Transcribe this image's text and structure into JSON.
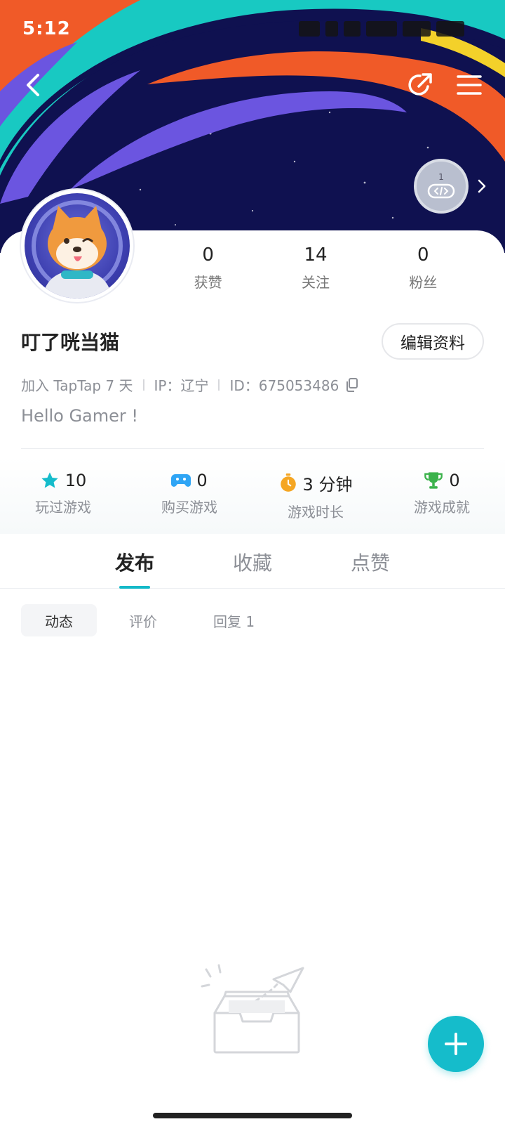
{
  "status_bar": {
    "time": "5:12"
  },
  "profile": {
    "username": "叮了咣当猫",
    "edit_label": "编辑资料",
    "joined": "加入 TapTap 7 天",
    "ip": "IP：辽宁",
    "id": "ID：675053486",
    "bio": "Hello Gamer !",
    "badge_level": "1"
  },
  "stats": [
    {
      "value": "0",
      "label": "获赞"
    },
    {
      "value": "14",
      "label": "关注"
    },
    {
      "value": "0",
      "label": "粉丝"
    }
  ],
  "game_stats": [
    {
      "icon": "star-icon",
      "value": "10",
      "label": "玩过游戏",
      "color": "#15bccb"
    },
    {
      "icon": "gamepad-icon",
      "value": "0",
      "label": "购买游戏",
      "color": "#2fa5f5"
    },
    {
      "icon": "timer-icon",
      "value": "3 分钟",
      "label": "游戏时长",
      "color": "#f5a623"
    },
    {
      "icon": "trophy-icon",
      "value": "0",
      "label": "游戏成就",
      "color": "#3bb24b"
    }
  ],
  "tabs": [
    {
      "label": "发布",
      "active": true
    },
    {
      "label": "收藏",
      "active": false
    },
    {
      "label": "点赞",
      "active": false
    }
  ],
  "subtabs": [
    {
      "label": "动态",
      "active": true
    },
    {
      "label": "评价",
      "active": false
    },
    {
      "label": "回复 1",
      "active": false
    }
  ],
  "colors": {
    "accent": "#15bccb",
    "banner_bg": "#0f1150"
  }
}
